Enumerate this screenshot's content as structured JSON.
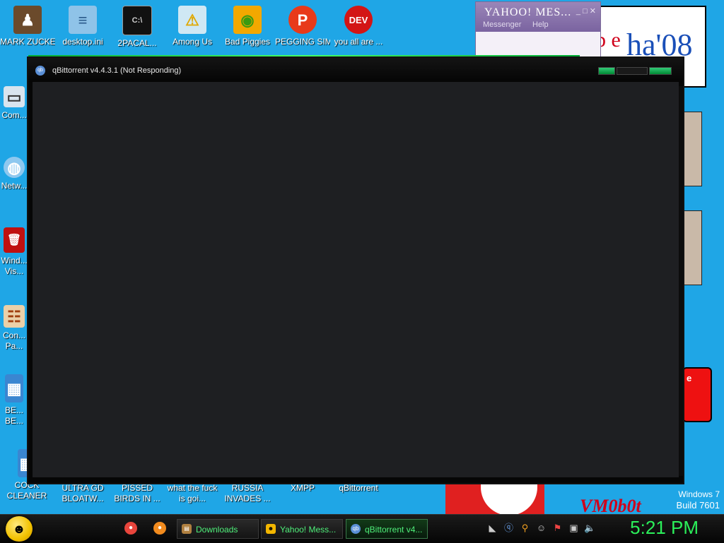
{
  "desktop": {
    "icons": [
      {
        "label": "MARK ZUCKER...",
        "glyph": "♟",
        "bg": "#6b4a2b"
      },
      {
        "label": "desktop.ini",
        "glyph": "≡",
        "bg": "#8fc3e8"
      },
      {
        "label": "2PACAL...",
        "glyph": "C:\\",
        "bg": "#111111"
      },
      {
        "label": "Among Us",
        "glyph": "⚠",
        "bg": "#cfe8f4"
      },
      {
        "label": "Bad Piggies",
        "glyph": "◉",
        "bg": "#7ccf2a"
      },
      {
        "label": "PEGGING SIMUL...",
        "glyph": "P",
        "bg": "#e83a1a"
      },
      {
        "label": "you all are ...",
        "glyph": "DEV",
        "bg": "#d31515"
      },
      {
        "label": "Com...",
        "glyph": "▭",
        "bg": "#d8e4ee"
      },
      {
        "label": "Netw...",
        "glyph": "◍",
        "bg": "#8ec8ef"
      },
      {
        "label": "Wind... Vis...",
        "glyph": "🗑",
        "bg": "#c01010"
      },
      {
        "label": "Con... Pa...",
        "glyph": "☷",
        "bg": "#ebd0a8"
      },
      {
        "label": "BE... BE...",
        "glyph": "▦",
        "bg": "#3a86d1"
      },
      {
        "label": "COCK CLEANER",
        "glyph": "▦",
        "bg": "#3a86d1"
      },
      {
        "label": "ULTRA GD BLOATW...",
        "glyph": "",
        "bg": "transparent"
      },
      {
        "label": "PISSED BIRDS IN ...",
        "glyph": "",
        "bg": "transparent"
      },
      {
        "label": "what the fuck is goi...",
        "glyph": "",
        "bg": "transparent"
      },
      {
        "label": "RUSSIA INVADES ...",
        "glyph": "",
        "bg": "transparent"
      },
      {
        "label": "XMPP",
        "glyph": "",
        "bg": "transparent"
      },
      {
        "label": "qBittorrent",
        "glyph": "",
        "bg": "transparent"
      }
    ],
    "watermark_line1": "Windows 7",
    "watermark_line2": "Build 7601",
    "wallpaper_text": "VM0b0t",
    "logo_text_a": "p e",
    "logo_text_b": "ha'08",
    "redbox_text": "e"
  },
  "yahoo_window": {
    "title": "YAHOO! MES...",
    "menu_messenger": "Messenger",
    "menu_help": "Help",
    "controls": "_ □ ✕"
  },
  "qb_window": {
    "title": "qBittorrent v4.4.3.1 (Not Responding)",
    "logo": "qb"
  },
  "taskbar": {
    "start_glyph": "☻",
    "quick_launch": [
      {
        "name": "chrome",
        "glyph": "●",
        "color": "#e8453c"
      },
      {
        "name": "firefox",
        "glyph": "●",
        "color": "#f28b1e"
      }
    ],
    "buttons": [
      {
        "label": "Downloads",
        "icon": "▤",
        "icon_bg": "#b08040"
      },
      {
        "label": "Yahoo! Mess...",
        "icon": "☻",
        "icon_bg": "#f2b600"
      },
      {
        "label": "qBittorrent v4...",
        "icon": "qb",
        "icon_bg": "#5a8fd6"
      }
    ],
    "tray_icons": [
      "◣",
      "ⓠ",
      "⚲",
      "☺",
      "⚑",
      "▣",
      "🔈"
    ],
    "clock": "5:21 PM"
  },
  "colors": {
    "desktop_bg": "#1fa6e6",
    "taskbar_text": "#4ff07a",
    "clock": "#2bf05a",
    "accent_green": "#33cc66"
  }
}
